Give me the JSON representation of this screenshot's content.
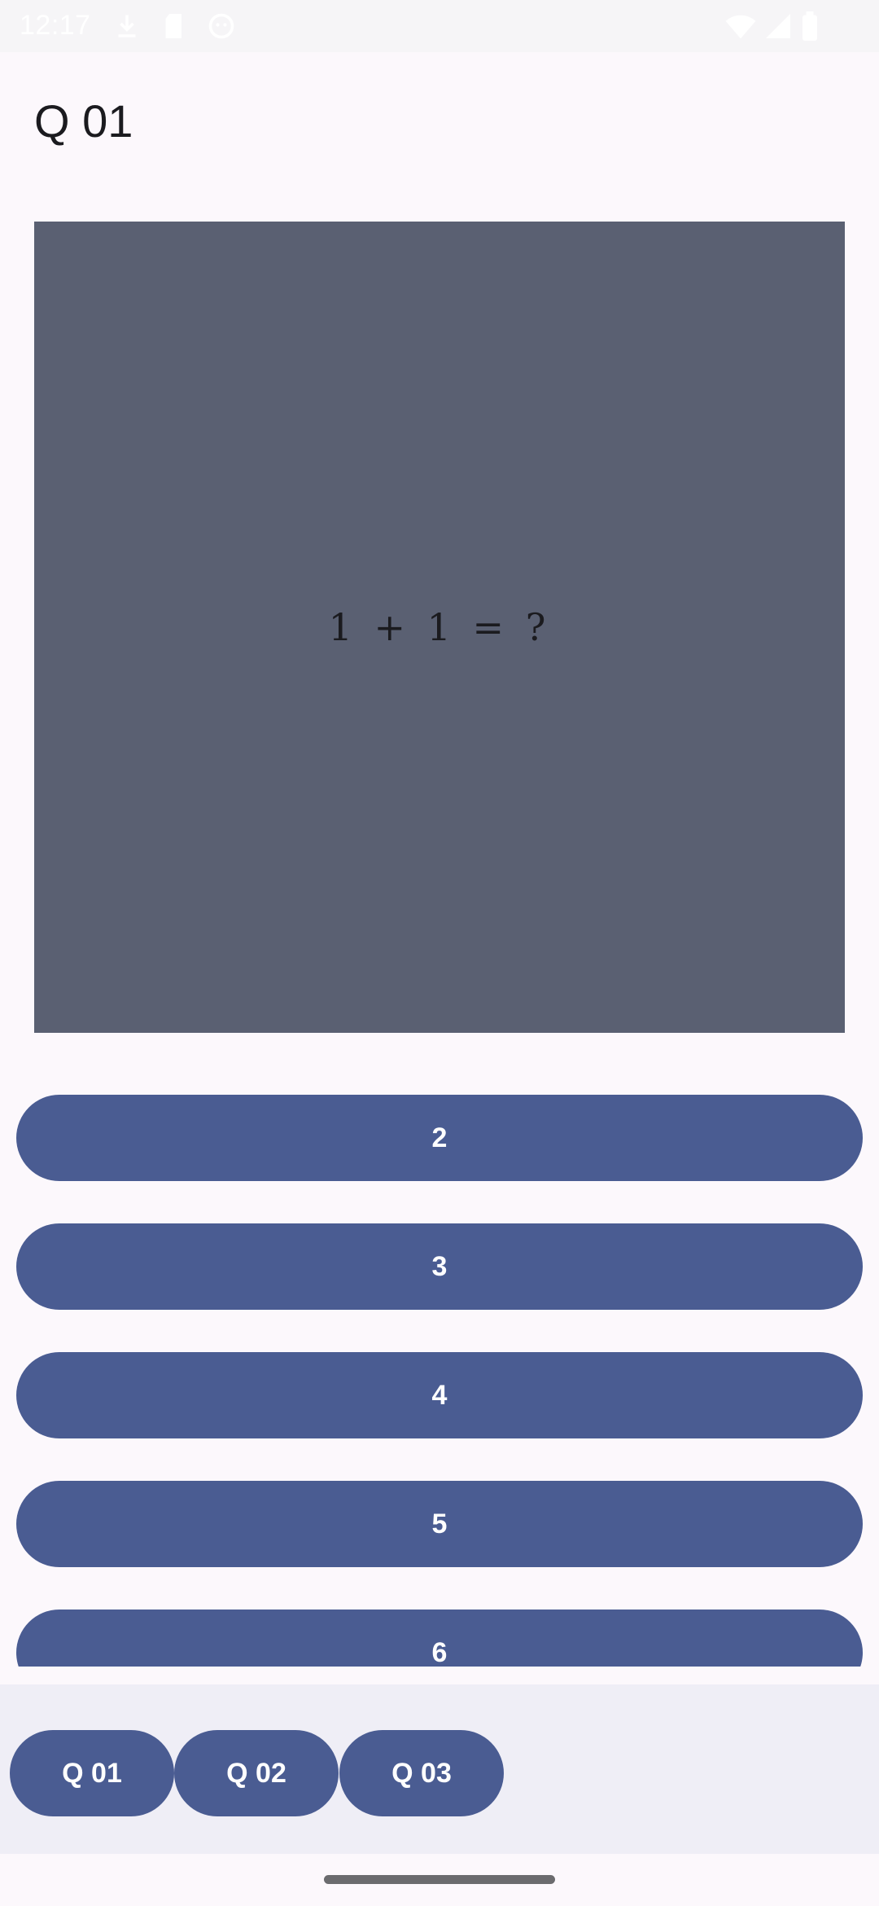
{
  "status_bar": {
    "time": "12:17",
    "icons": [
      "download-icon",
      "sd-card-icon",
      "face-icon",
      "wifi-icon",
      "signal-icon",
      "battery-icon"
    ]
  },
  "page": {
    "title": "Q 01"
  },
  "question": {
    "text": "1 + 1 = ?",
    "card_color": "#5a6072"
  },
  "answers": [
    {
      "label": "2"
    },
    {
      "label": "3"
    },
    {
      "label": "4"
    },
    {
      "label": "5"
    },
    {
      "label": "6"
    }
  ],
  "bottom_nav": {
    "items": [
      {
        "label": "Q 01"
      },
      {
        "label": "Q 02"
      },
      {
        "label": "Q 03"
      }
    ]
  },
  "colors": {
    "accent": "#4a5c92",
    "background": "#fcf8fc",
    "bottom_bar": "#efeef6"
  }
}
